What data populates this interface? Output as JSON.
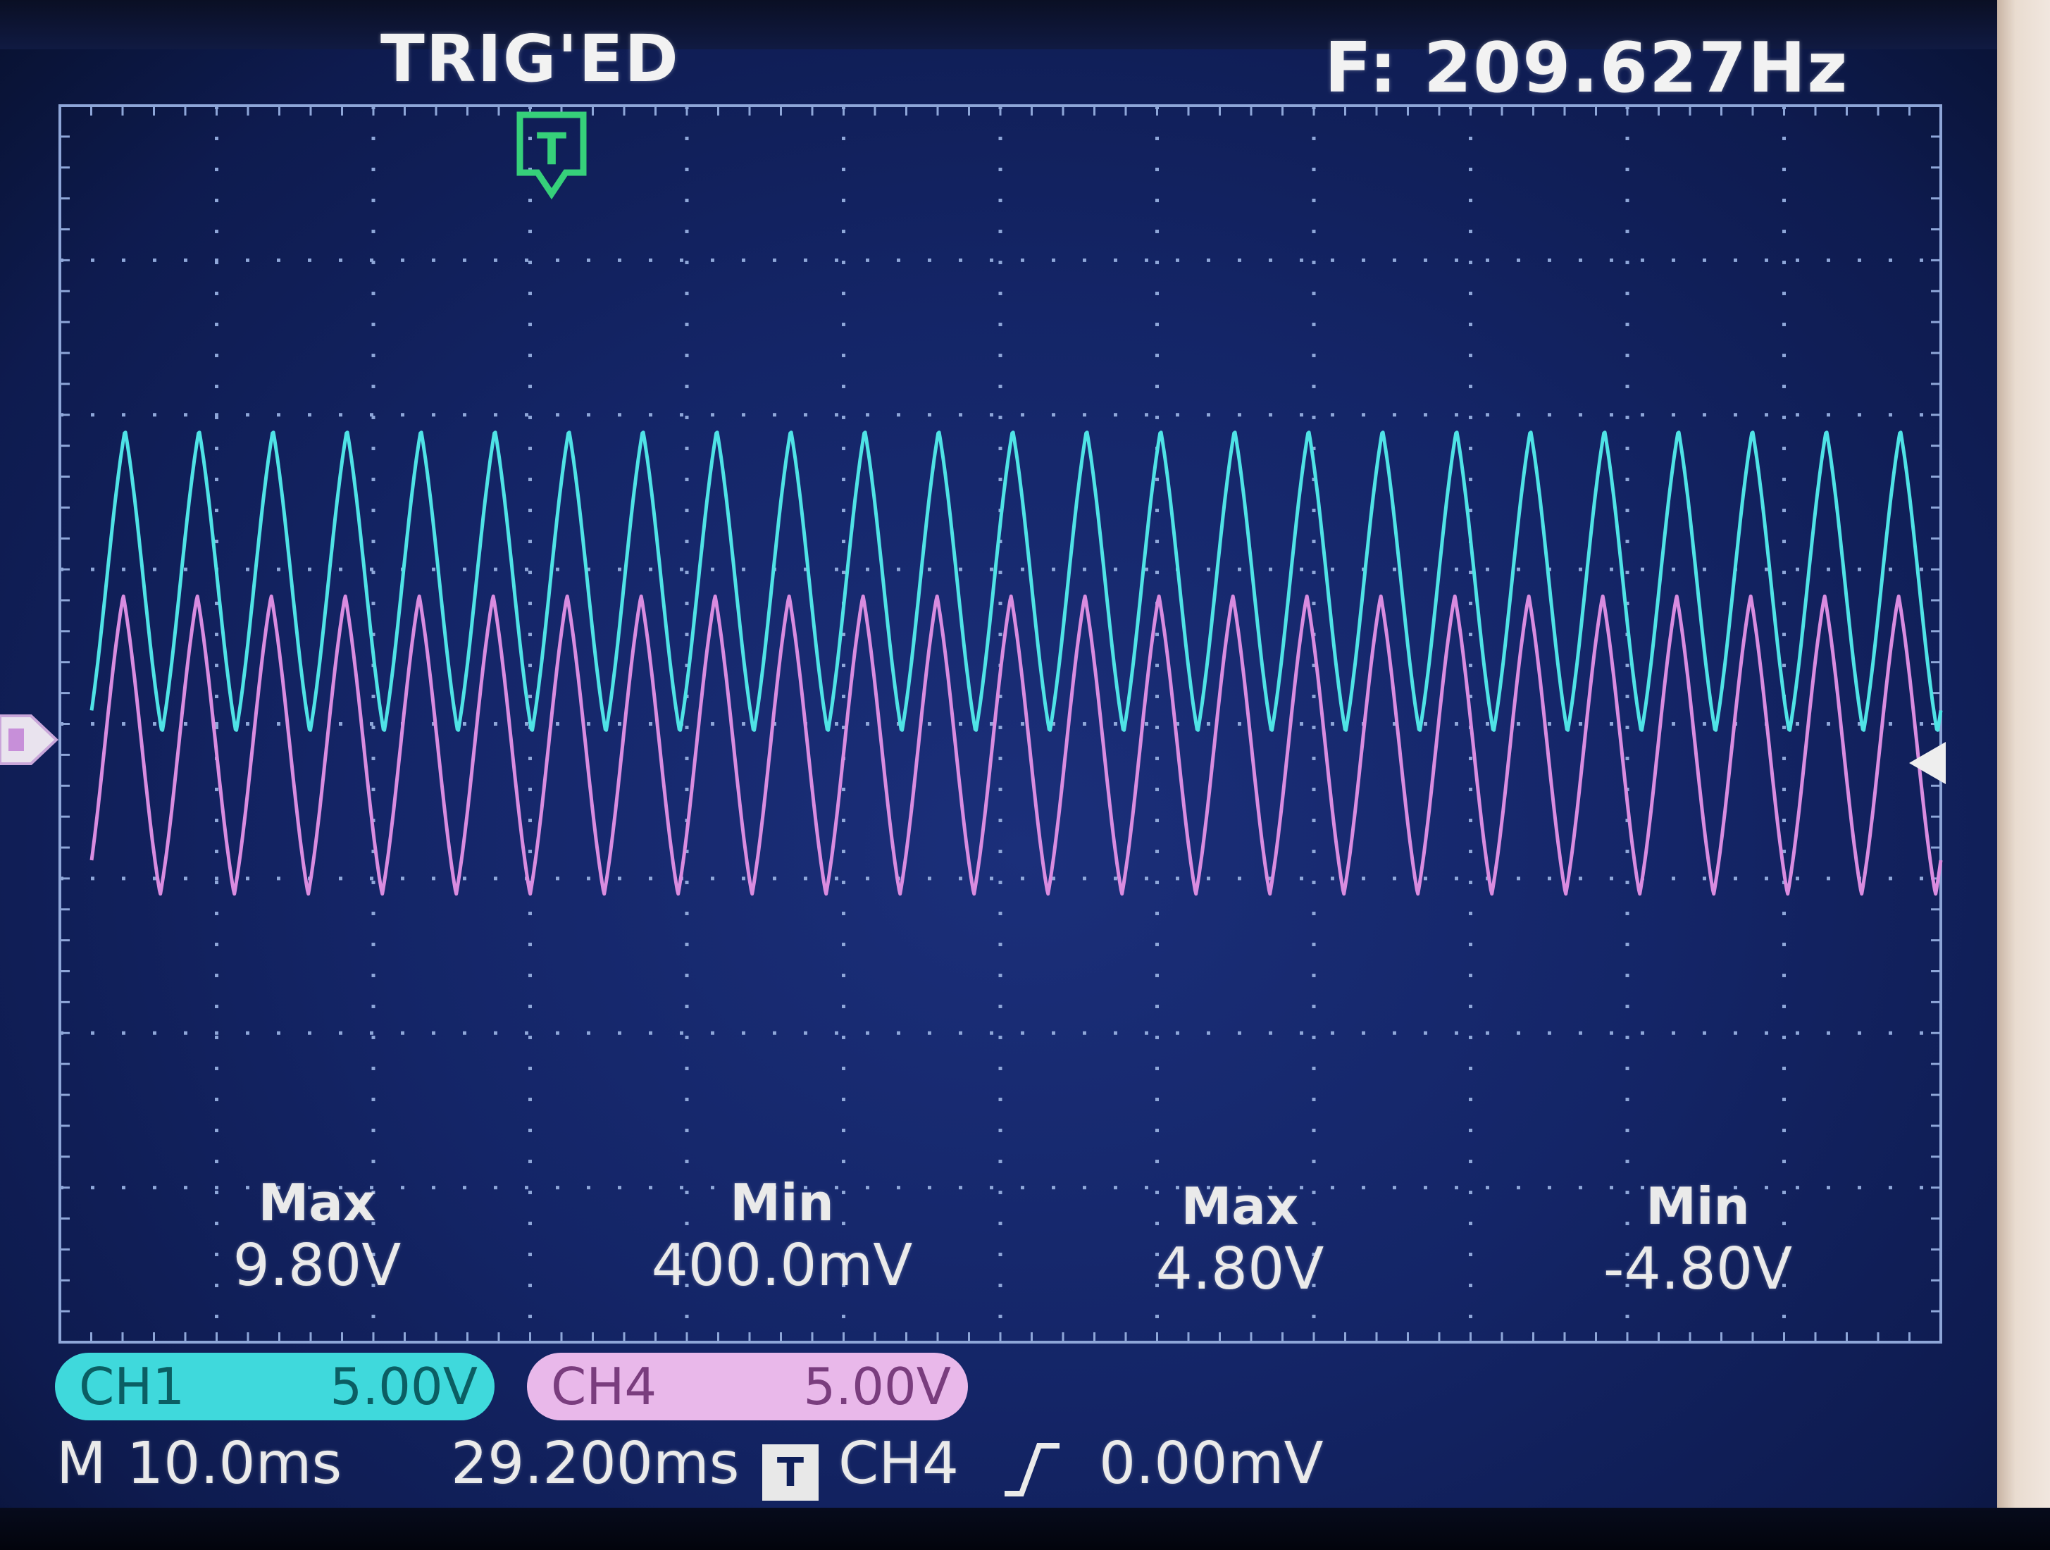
{
  "header": {
    "trigger_status": "TRIG'ED",
    "frequency": "F: 209.627Hz"
  },
  "trigger_marker": {
    "label": "T",
    "icon": "trigger-position-icon"
  },
  "ground_marker": {
    "icon": "channel-ground-arrow-icon"
  },
  "trigger_level_marker": {
    "icon": "trigger-level-arrow-icon"
  },
  "measurements": [
    {
      "label": "Max",
      "value": "9.80V"
    },
    {
      "label": "Min",
      "value": "400.0mV"
    },
    {
      "label": "Max",
      "value": "4.80V"
    },
    {
      "label": "Min",
      "value": "-4.80V"
    }
  ],
  "channels": [
    {
      "name": "CH1",
      "scale": "5.00V",
      "color": "#3fd9dc"
    },
    {
      "name": "CH4",
      "scale": "5.00V",
      "color": "#e9b8ea"
    }
  ],
  "timebase": {
    "mode": "M",
    "time_per_div": "10.0ms",
    "delay": "29.200ms",
    "trigger_icon_label": "T",
    "trigger_source": "CH4",
    "trigger_edge_icon": "rising-edge-icon",
    "trigger_level": "0.00mV"
  },
  "colors": {
    "screen_bg": "#142567",
    "grid": "#8ea6d8",
    "ch1_trace": "#4fe3e6",
    "ch4_trace": "#d98ce0",
    "trigger_marker": "#36d07a"
  }
}
